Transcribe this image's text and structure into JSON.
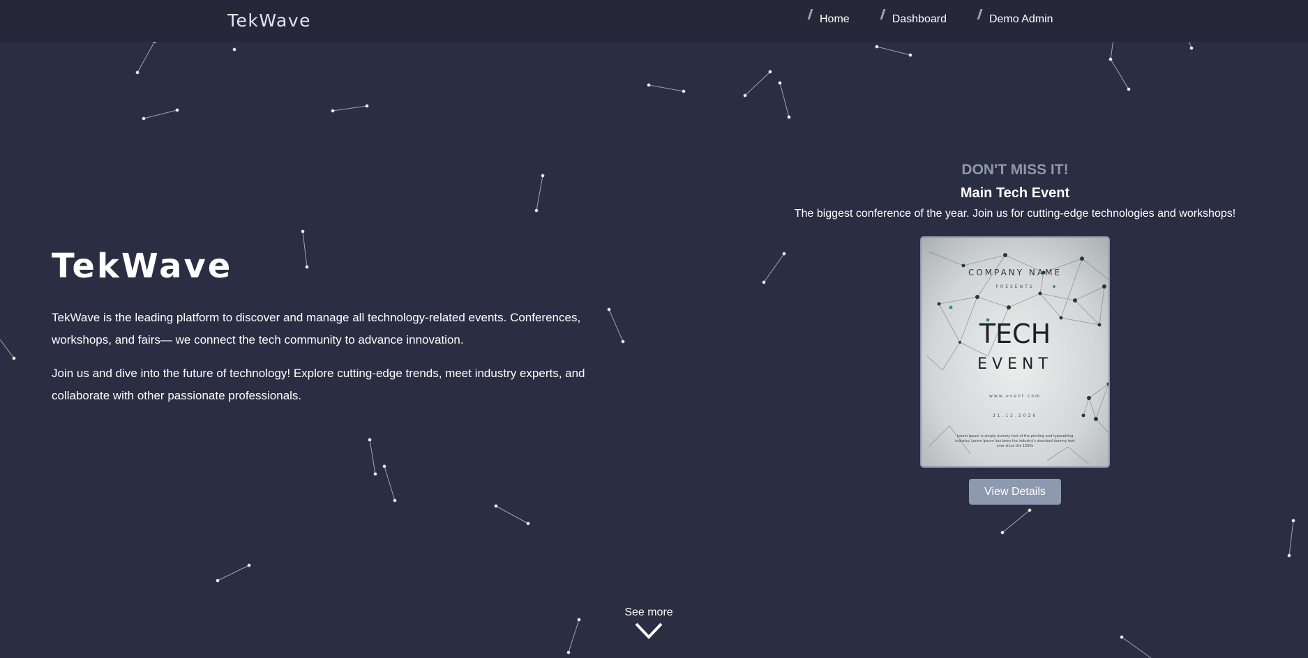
{
  "navbar": {
    "brand": "TekWave",
    "links": [
      {
        "label": "Home"
      },
      {
        "label": "Dashboard"
      },
      {
        "label": "Demo Admin"
      }
    ]
  },
  "hero": {
    "title": "TekWave",
    "paragraph1": "TekWave is the leading platform to discover and manage all technology-related events. Conferences, workshops, and fairs— we connect the tech community to advance innovation.",
    "paragraph2": "Join us and dive into the future of technology! Explore cutting-edge trends, meet industry experts, and collaborate with other passionate professionals."
  },
  "event": {
    "kicker": "DON'T MISS IT!",
    "title": "Main Tech Event",
    "description": "The biggest conference of the year. Join us for cutting-edge technologies and workshops!",
    "poster": {
      "company": "COMPANY NAME",
      "presents": "PRESENTS",
      "title_line1": "TECH",
      "title_line2": "EVENT",
      "website": "www.event.com",
      "date": "31.12.2026",
      "blurb": "Lorem Ipsum is simply dummy text of the printing and typesetting industry. Lorem Ipsum has been the industry's standard dummy text ever since the 1500s"
    },
    "button_label": "View Details"
  },
  "see_more": {
    "label": "See more"
  },
  "colors": {
    "background": "#2b2d42",
    "navbar": "#26283a",
    "accent": "#8d99ae",
    "text": "#ffffff"
  }
}
